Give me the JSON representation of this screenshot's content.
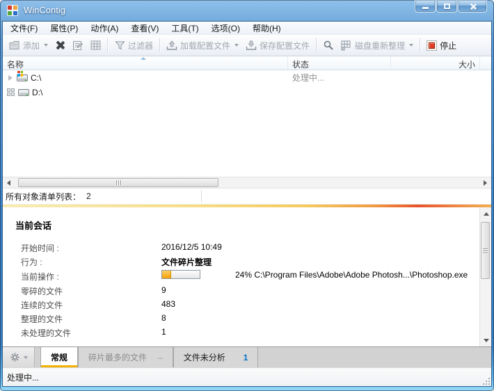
{
  "window": {
    "title": "WinContig"
  },
  "menu": [
    "文件(F)",
    "属性(P)",
    "动作(A)",
    "查看(V)",
    "工具(T)",
    "选项(O)",
    "帮助(H)"
  ],
  "toolbar": {
    "add": "添加",
    "filter": "过滤器",
    "load_profile": "加载配置文件",
    "save_profile": "保存配置文件",
    "defrag": "磁盘重新整理",
    "stop": "停止"
  },
  "list": {
    "columns": {
      "name": "名称",
      "status": "状态",
      "size": "大小"
    },
    "rows": [
      {
        "name": "C:\\",
        "status": "处理中...",
        "size": ""
      },
      {
        "name": "D:\\",
        "status": "",
        "size": ""
      }
    ],
    "footer": {
      "label": "所有对象清单列表：",
      "count": "2"
    }
  },
  "session": {
    "heading": "当前会话",
    "start_label": "开始时间 :",
    "start_value": "2016/12/5 10:49",
    "action_label": "行为 :",
    "action_value": "文件碎片整理",
    "operation_label": "当前操作 :",
    "operation_percent": 24,
    "operation_text": "24% C:\\Program Files\\Adobe\\Adobe Photosh...\\Photoshop.exe",
    "fragmented_label": "零碎的文件",
    "fragmented_value": "9",
    "contiguous_label": "连续的文件",
    "contiguous_value": "483",
    "defragmented_label": "整理的文件",
    "defragmented_value": "8",
    "unprocessed_label": "未处理的文件",
    "unprocessed_value": "1"
  },
  "tabs": {
    "general": "常规",
    "most_fragmented": "碎片最多的文件",
    "most_fragmented_suffix": "–",
    "unanalyzed": "文件未分析",
    "unanalyzed_badge": "1"
  },
  "statusbar": {
    "text": "处理中..."
  },
  "icons": {
    "app": "color-grid",
    "add": "folder-icon",
    "delete": "x-mark-icon",
    "properties": "note-icon",
    "view": "grid-icon",
    "filter": "funnel-icon",
    "load": "tray-arrow-up-icon",
    "save": "tray-arrow-down-icon",
    "analyze": "magnifier-icon",
    "defrag": "block-grid-icon",
    "stop": "red-square-icon",
    "expander": "triangle-right-icon",
    "working": "square-grid-icon",
    "drive": "hard-disk-icon",
    "gear": "gear-icon",
    "sort": "triangle-up-icon"
  },
  "colors": {
    "titlebar_blue": "#3f82c4",
    "accent_orange": "#f2b200",
    "progress_fill": "#f5a009",
    "badge_blue": "#0072c6",
    "stop_red": "#e03c28",
    "disabled_gray": "#a3a9b1"
  }
}
